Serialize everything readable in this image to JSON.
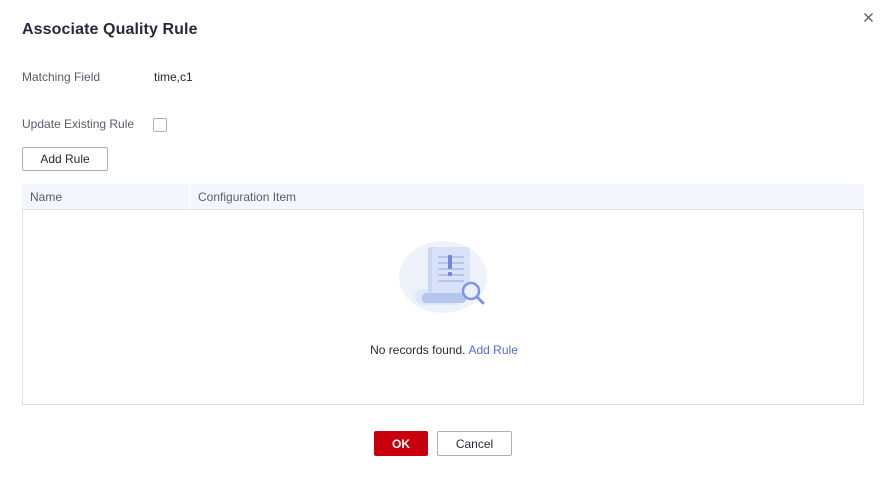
{
  "dialog": {
    "title": "Associate Quality Rule",
    "close_icon": "close-icon"
  },
  "fields": {
    "matching_field_label": "Matching Field",
    "matching_field_value": "time,c1",
    "update_existing_label": "Update Existing Rule",
    "update_existing_checked": false
  },
  "toolbar": {
    "add_rule_label": "Add Rule"
  },
  "table": {
    "columns": [
      "Name",
      "Configuration Item"
    ],
    "rows": [],
    "empty_icon": "empty-records-icon",
    "empty_text": "No records found.",
    "empty_link": "Add Rule"
  },
  "footer": {
    "ok_label": "OK",
    "cancel_label": "Cancel"
  },
  "colors": {
    "primary": "#c7000b",
    "link": "#526ecc",
    "table_header_bg": "#f3f6fc",
    "border": "#dfe1e6"
  }
}
